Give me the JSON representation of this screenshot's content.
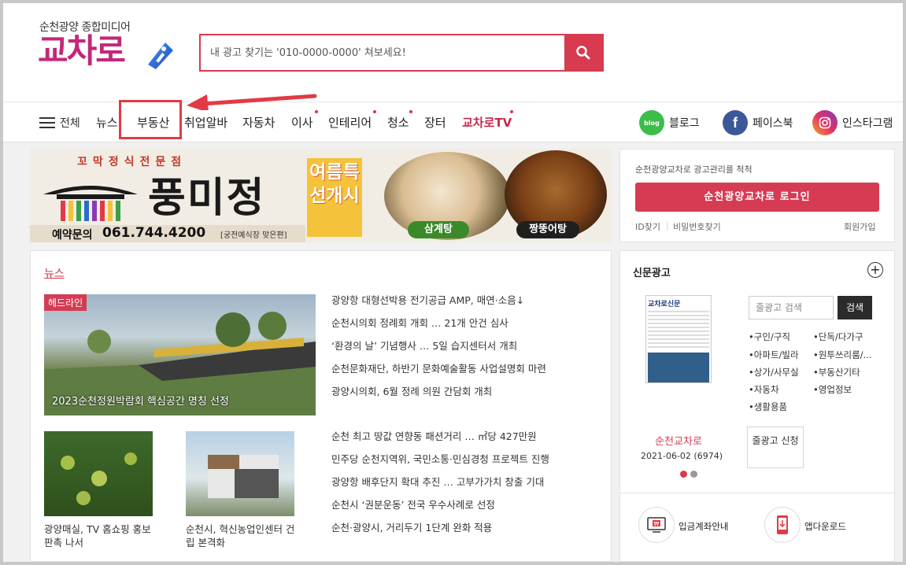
{
  "header": {
    "logo_subtitle": "순천광양 종합미디어",
    "logo_text": "교차로",
    "search_placeholder": "내 광고 찾기는 '010-0000-0000' 쳐보세요!"
  },
  "nav": {
    "all_label": "전체",
    "items": [
      "뉴스",
      "부동산",
      "취업알바",
      "자동차",
      "이사",
      "인테리어",
      "청소",
      "장터",
      "교차로TV"
    ],
    "social": [
      "블로그",
      "페이스북",
      "인스타그램"
    ]
  },
  "banner": {
    "top_text": "꼬막정식전문점",
    "name": "풍미정",
    "phone_label": "예약문의",
    "phone": "061.744.4200",
    "phone_note": "[궁전예식장 맞은편]",
    "promo": "여름특선개시",
    "food1": "삼계탕",
    "food2": "짱뚱어탕"
  },
  "login": {
    "desc": "순천광양교차로 광고관리를 척척",
    "button": "순천광양교차로 로그인",
    "find_id": "ID찾기",
    "find_pw": "비밀번호찾기",
    "signup": "회원가입"
  },
  "news": {
    "title": "뉴스",
    "headline_badge": "헤드라인",
    "headline_caption": "2023순천정원박람회 핵심공간 명칭 선정",
    "list1": [
      "광양항 대형선박용 전기공급 AMP, 매연·소음↓",
      "순천시의회 정례회 개회 … 21개 안건 심사",
      "‘환경의 날’ 기념행사 … 5일 습지센터서 개최",
      "순천문화재단, 하반기 문화예술활동 사업설명회 마련",
      "광양시의회, 6월 정례 의원 간담회 개최"
    ],
    "thumb1_caption": "광양매실, TV 홈쇼핑 홍보 판촉 나서",
    "thumb2_caption": "순천시, 혁신농업인센터 건립 본격화",
    "list2": [
      "순천 최고 땅값 연향동 패션거리 … ㎡당 427만원",
      "민주당 순천지역위, 국민소통·민심경청 프로젝트 진행",
      "광양항 배후단지 확대 추진 … 고부가가치 창출 기대",
      "순천시 ‘권분운동’ 전국 우수사례로 선정",
      "순천·광양시, 거리두기 1단계 완화 적용"
    ]
  },
  "paper": {
    "title": "신문광고",
    "thumb_title": "교차로신문",
    "name": "순천교차로",
    "date": "2021-06-02 (6974)",
    "search_placeholder": "줄광고 검색",
    "search_button": "검색",
    "categories_left": [
      "•구인/구직",
      "•아파트/빌라",
      "•상가/사무실",
      "•자동차",
      "•생활용품"
    ],
    "categories_right": [
      "•단독/다가구",
      "•원투쓰리룸/...",
      "•부동산기타",
      "•영업정보"
    ],
    "request_button": "줄광고 신청"
  },
  "bottom": {
    "deposit": "입금계좌안내",
    "app": "앱다운로드"
  },
  "colors": {
    "brand": "#c3287a",
    "accent": "#d63b53",
    "highlight": "#e23a44"
  }
}
